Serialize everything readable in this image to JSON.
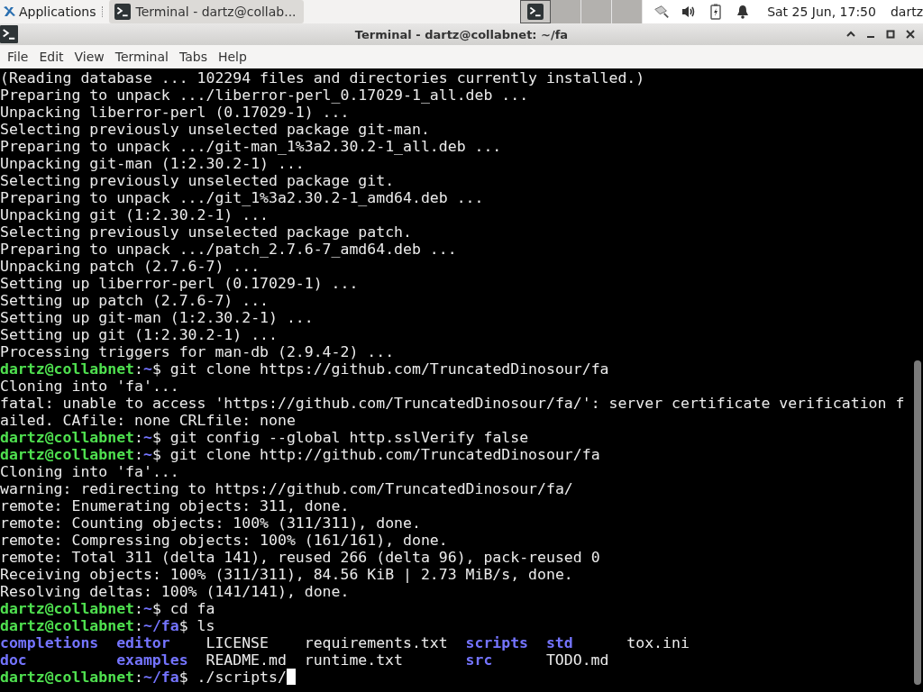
{
  "panel": {
    "menu_label": "Applications",
    "tasks": [
      {
        "label": "Terminal - dartz@collab...",
        "selected": true
      }
    ],
    "workspaces": [
      {
        "selected": true,
        "has_window": true
      },
      {
        "selected": false,
        "has_window": false
      },
      {
        "selected": false,
        "has_window": false
      },
      {
        "selected": false,
        "has_window": false
      }
    ],
    "clock": "Sat 25 Jun, 17:50",
    "user": "dartz"
  },
  "window": {
    "title": "Terminal - dartz@collabnet: ~/fa"
  },
  "menu": [
    "File",
    "Edit",
    "View",
    "Terminal",
    "Tabs",
    "Help"
  ],
  "terminal": {
    "lines": [
      {
        "kind": "output",
        "text": "(Reading database ... 102294 files and directories currently installed.)"
      },
      {
        "kind": "output",
        "text": "Preparing to unpack .../liberror-perl_0.17029-1_all.deb ..."
      },
      {
        "kind": "output",
        "text": "Unpacking liberror-perl (0.17029-1) ..."
      },
      {
        "kind": "output",
        "text": "Selecting previously unselected package git-man."
      },
      {
        "kind": "output",
        "text": "Preparing to unpack .../git-man_1%3a2.30.2-1_all.deb ..."
      },
      {
        "kind": "output",
        "text": "Unpacking git-man (1:2.30.2-1) ..."
      },
      {
        "kind": "output",
        "text": "Selecting previously unselected package git."
      },
      {
        "kind": "output",
        "text": "Preparing to unpack .../git_1%3a2.30.2-1_amd64.deb ..."
      },
      {
        "kind": "output",
        "text": "Unpacking git (1:2.30.2-1) ..."
      },
      {
        "kind": "output",
        "text": "Selecting previously unselected package patch."
      },
      {
        "kind": "output",
        "text": "Preparing to unpack .../patch_2.7.6-7_amd64.deb ..."
      },
      {
        "kind": "output",
        "text": "Unpacking patch (2.7.6-7) ..."
      },
      {
        "kind": "output",
        "text": "Setting up liberror-perl (0.17029-1) ..."
      },
      {
        "kind": "output",
        "text": "Setting up patch (2.7.6-7) ..."
      },
      {
        "kind": "output",
        "text": "Setting up git-man (1:2.30.2-1) ..."
      },
      {
        "kind": "output",
        "text": "Setting up git (1:2.30.2-1) ..."
      },
      {
        "kind": "output",
        "text": "Processing triggers for man-db (2.9.4-2) ..."
      },
      {
        "kind": "prompt",
        "user": "dartz@collabnet",
        "sep": ":",
        "path": "~",
        "command": "$ git clone https://github.com/TruncatedDinosour/fa",
        "cursor": false
      },
      {
        "kind": "output",
        "text": "Cloning into 'fa'..."
      },
      {
        "kind": "output",
        "text": "fatal: unable to access 'https://github.com/TruncatedDinosour/fa/': server certificate verification f"
      },
      {
        "kind": "output",
        "text": "ailed. CAfile: none CRLfile: none"
      },
      {
        "kind": "prompt",
        "user": "dartz@collabnet",
        "sep": ":",
        "path": "~",
        "command": "$ git config --global http.sslVerify false",
        "cursor": false
      },
      {
        "kind": "prompt",
        "user": "dartz@collabnet",
        "sep": ":",
        "path": "~",
        "command": "$ git clone http://github.com/TruncatedDinosour/fa",
        "cursor": false
      },
      {
        "kind": "output",
        "text": "Cloning into 'fa'..."
      },
      {
        "kind": "output",
        "text": "warning: redirecting to https://github.com/TruncatedDinosour/fa/"
      },
      {
        "kind": "output",
        "text": "remote: Enumerating objects: 311, done."
      },
      {
        "kind": "output",
        "text": "remote: Counting objects: 100% (311/311), done."
      },
      {
        "kind": "output",
        "text": "remote: Compressing objects: 100% (161/161), done."
      },
      {
        "kind": "output",
        "text": "remote: Total 311 (delta 141), reused 266 (delta 96), pack-reused 0"
      },
      {
        "kind": "output",
        "text": "Receiving objects: 100% (311/311), 84.56 KiB | 2.73 MiB/s, done."
      },
      {
        "kind": "output",
        "text": "Resolving deltas: 100% (141/141), done."
      },
      {
        "kind": "prompt",
        "user": "dartz@collabnet",
        "sep": ":",
        "path": "~",
        "command": "$ cd fa",
        "cursor": false
      },
      {
        "kind": "prompt",
        "user": "dartz@collabnet",
        "sep": ":",
        "path": "~/fa",
        "command": "$ ls",
        "cursor": false
      },
      {
        "kind": "ls",
        "entries": [
          {
            "name": "completions",
            "kind": "dir"
          },
          {
            "name": "editor",
            "kind": "dir"
          },
          {
            "name": "LICENSE",
            "kind": "file"
          },
          {
            "name": "requirements.txt",
            "kind": "file"
          },
          {
            "name": "scripts",
            "kind": "dir"
          },
          {
            "name": "std",
            "kind": "dir"
          },
          {
            "name": "tox.ini",
            "kind": "file"
          }
        ]
      },
      {
        "kind": "ls",
        "entries": [
          {
            "name": "doc",
            "kind": "dir"
          },
          {
            "name": "examples",
            "kind": "dir"
          },
          {
            "name": "README.md",
            "kind": "file"
          },
          {
            "name": "runtime.txt",
            "kind": "file"
          },
          {
            "name": "src",
            "kind": "dir"
          },
          {
            "name": "TODO.md",
            "kind": "file"
          }
        ]
      },
      {
        "kind": "prompt",
        "user": "dartz@collabnet",
        "sep": ":",
        "path": "~/fa",
        "command": "$ ./scripts/",
        "cursor": true
      }
    ]
  }
}
